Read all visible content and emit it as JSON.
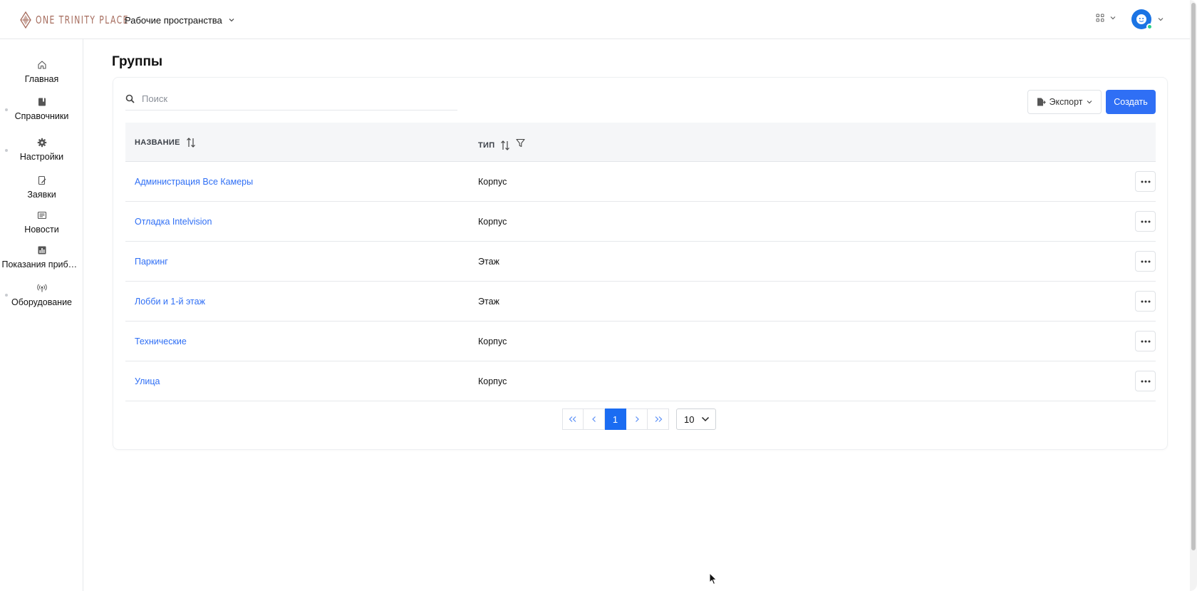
{
  "brand": {
    "name": "ONE TRINITY PLACE"
  },
  "header": {
    "workspace_label": "Рабочие пространства",
    "apps_icon": "grid-icon",
    "user_icon": "avatar"
  },
  "sidebar": {
    "items": [
      {
        "label": "Главная",
        "icon": "home-icon"
      },
      {
        "label": "Справочники",
        "icon": "book-icon"
      },
      {
        "label": "Настройки",
        "icon": "gear-icon"
      },
      {
        "label": "Заявки",
        "icon": "request-icon"
      },
      {
        "label": "Новости",
        "icon": "newspaper-icon"
      },
      {
        "label": "Показания прибо…",
        "icon": "bar-chart-icon"
      },
      {
        "label": "Оборудование",
        "icon": "antenna-icon"
      }
    ]
  },
  "page": {
    "title": "Группы"
  },
  "toolbar": {
    "search_placeholder": "Поиск",
    "export_label": "Экспорт",
    "create_label": "Создать"
  },
  "table": {
    "columns": [
      "НАЗВАНИЕ",
      "ТИП"
    ],
    "rows": [
      {
        "name": "Администрация Все Камеры",
        "type": "Корпус"
      },
      {
        "name": "Отладка Intelvision",
        "type": "Корпус"
      },
      {
        "name": "Паркинг",
        "type": "Этаж"
      },
      {
        "name": "Лобби и 1-й этаж",
        "type": "Этаж"
      },
      {
        "name": "Технические",
        "type": "Корпус"
      },
      {
        "name": "Улица",
        "type": "Корпус"
      }
    ]
  },
  "pagination": {
    "current_page": "1",
    "page_size": "10"
  },
  "colors": {
    "accent": "#2f6ff5",
    "active_page": "#1b6cf2",
    "brand": "#a56b5c",
    "online": "#2bd18a"
  }
}
